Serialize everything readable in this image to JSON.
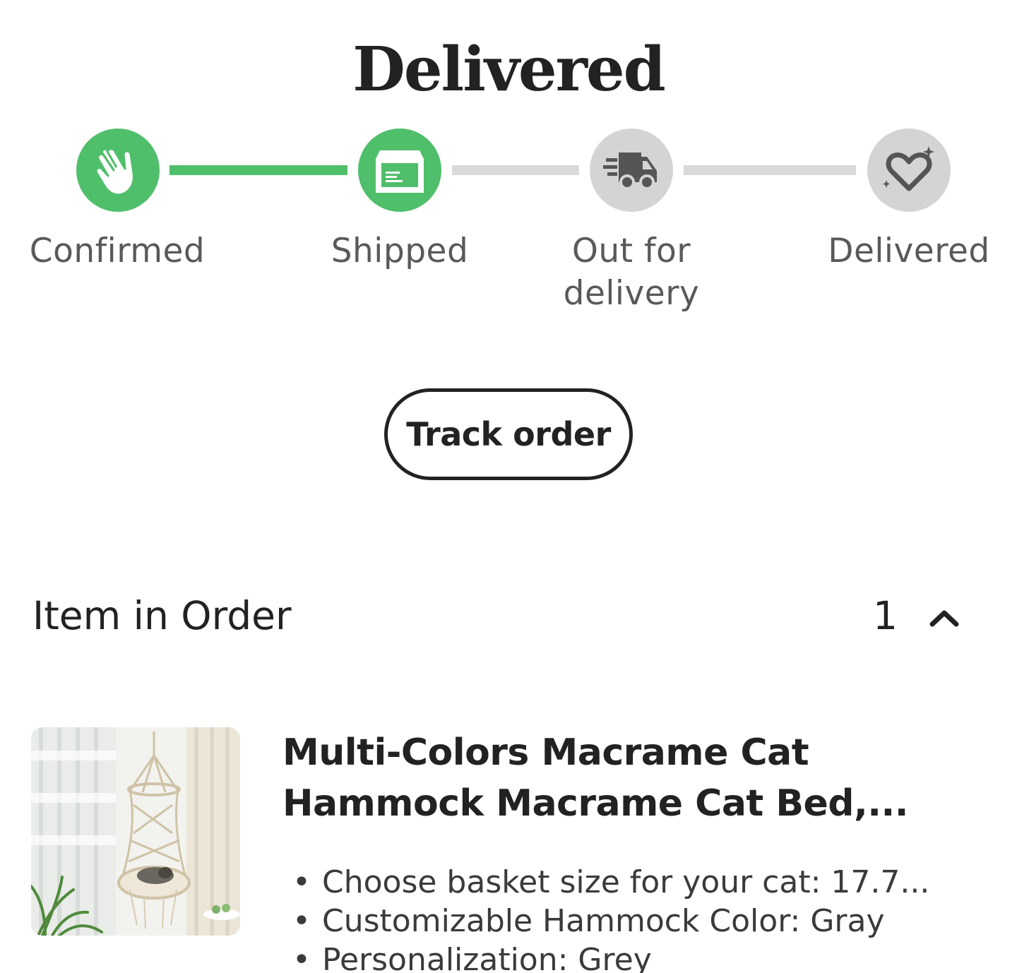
{
  "order_status": {
    "title": "Delivered",
    "steps": [
      {
        "label": "Confirmed",
        "icon": "waving-hand-icon",
        "state": "done"
      },
      {
        "label": "Shipped",
        "icon": "package-box-icon",
        "state": "done"
      },
      {
        "label_line1": "Out for",
        "label_line2": "delivery",
        "icon": "delivery-truck-icon",
        "state": "pending"
      },
      {
        "label": "Delivered",
        "icon": "sparkle-heart-icon",
        "state": "pending"
      }
    ],
    "colors": {
      "done": "#4fbf6b",
      "pending": "#d4d4d4",
      "pending_icon": "#555555"
    }
  },
  "actions": {
    "track_order_label": "Track order"
  },
  "items_section": {
    "header": "Item in Order",
    "count": "1",
    "toggle_icon": "chevron-up-icon"
  },
  "item": {
    "title_line1": "Multi-Colors Macrame Cat",
    "title_line2": "Hammock Macrame Cat Bed,...",
    "image_icon": "product-photo",
    "variations": [
      "Choose basket size for your cat: 17.7...",
      "Customizable Hammock Color: Gray",
      "Personalization:  Grey"
    ]
  }
}
